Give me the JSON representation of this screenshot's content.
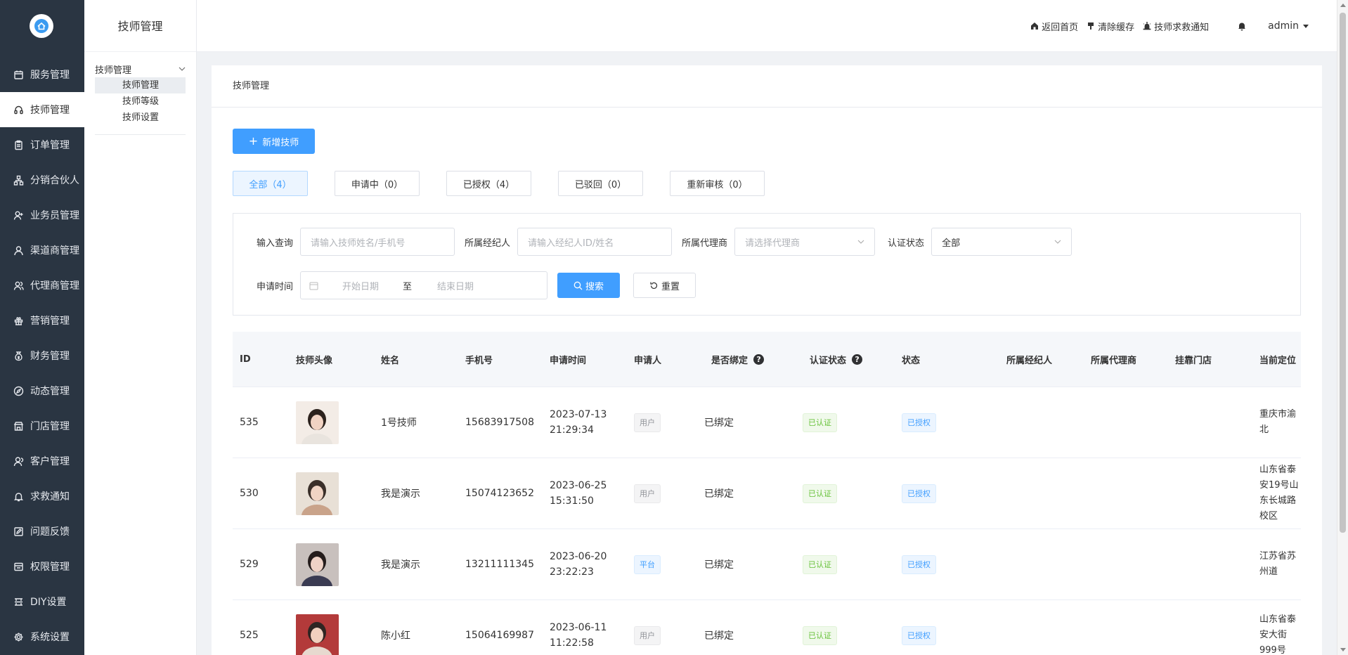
{
  "sidebar": {
    "items": [
      {
        "label": "服务管理",
        "icon": "calendar-icon"
      },
      {
        "label": "技师管理",
        "icon": "headset-icon",
        "active": true
      },
      {
        "label": "订单管理",
        "icon": "clipboard-icon"
      },
      {
        "label": "分销合伙人",
        "icon": "network-icon"
      },
      {
        "label": "业务员管理",
        "icon": "user-add-icon"
      },
      {
        "label": "渠道商管理",
        "icon": "user-icon"
      },
      {
        "label": "代理商管理",
        "icon": "users-icon"
      },
      {
        "label": "营销管理",
        "icon": "gift-icon"
      },
      {
        "label": "财务管理",
        "icon": "money-bag-icon"
      },
      {
        "label": "动态管理",
        "icon": "compass-icon"
      },
      {
        "label": "门店管理",
        "icon": "store-icon"
      },
      {
        "label": "客户管理",
        "icon": "customer-icon"
      },
      {
        "label": "求救通知",
        "icon": "bell-icon"
      },
      {
        "label": "问题反馈",
        "icon": "edit-box-icon"
      },
      {
        "label": "权限管理",
        "icon": "permission-icon"
      },
      {
        "label": "DIY设置",
        "icon": "diy-icon"
      },
      {
        "label": "系统设置",
        "icon": "gear-icon"
      }
    ]
  },
  "subsidebar": {
    "title": "技师管理",
    "group": "技师管理",
    "items": [
      {
        "label": "技师管理",
        "active": true
      },
      {
        "label": "技师等级"
      },
      {
        "label": "技师设置"
      }
    ]
  },
  "header": {
    "home": "返回首页",
    "clear_cache": "清除缓存",
    "sos": "技师求救通知",
    "user": "admin"
  },
  "card": {
    "title": "技师管理",
    "add_button": "新增技师"
  },
  "tabs": [
    {
      "label": "全部（4）",
      "active": true
    },
    {
      "label": "申请中（0）"
    },
    {
      "label": "已授权（4）"
    },
    {
      "label": "已驳回（0）"
    },
    {
      "label": "重新审核（0）"
    }
  ],
  "filter": {
    "query_label": "输入查询",
    "query_placeholder": "请输入技师姓名/手机号",
    "broker_label": "所属经纪人",
    "broker_placeholder": "请输入经纪人ID/姓名",
    "agent_label": "所属代理商",
    "agent_placeholder": "请选择代理商",
    "status_label": "认证状态",
    "status_value": "全部",
    "time_label": "申请时间",
    "start_placeholder": "开始日期",
    "range_sep": "至",
    "end_placeholder": "结束日期",
    "search_button": "搜索",
    "reset_button": "重置"
  },
  "table": {
    "columns": [
      "ID",
      "技师头像",
      "姓名",
      "手机号",
      "申请时间",
      "申请人",
      "是否绑定",
      "认证状态",
      "状态",
      "所属经纪人",
      "所属代理商",
      "挂靠门店",
      "当前定位"
    ],
    "rows": [
      {
        "id": "535",
        "name": "1号技师",
        "phone": "15683917508",
        "time": "2023-07-13 21:29:34",
        "applicant": "用户",
        "applicant_type": "user",
        "bound": "已绑定",
        "cert": "已认证",
        "status": "已授权",
        "location": "重庆市渝北"
      },
      {
        "id": "530",
        "name": "我是演示",
        "phone": "15074123652",
        "time": "2023-06-25 15:31:50",
        "applicant": "用户",
        "applicant_type": "user",
        "bound": "已绑定",
        "cert": "已认证",
        "status": "已授权",
        "location": "山东省泰安19号山东长城路校区"
      },
      {
        "id": "529",
        "name": "我是演示",
        "phone": "13211111345",
        "time": "2023-06-20 23:22:23",
        "applicant": "平台",
        "applicant_type": "platform",
        "bound": "已绑定",
        "cert": "已认证",
        "status": "已授权",
        "location": "江苏省苏州道"
      },
      {
        "id": "525",
        "name": "陈小红",
        "phone": "15064169987",
        "time": "2023-06-11 11:22:58",
        "applicant": "用户",
        "applicant_type": "user",
        "bound": "已绑定",
        "cert": "已认证",
        "status": "已授权",
        "location": "山东省泰安大街999号"
      }
    ]
  },
  "colors": {
    "sidebar_bg": "#2a3542",
    "primary": "#409eff",
    "success": "#67c23a"
  }
}
